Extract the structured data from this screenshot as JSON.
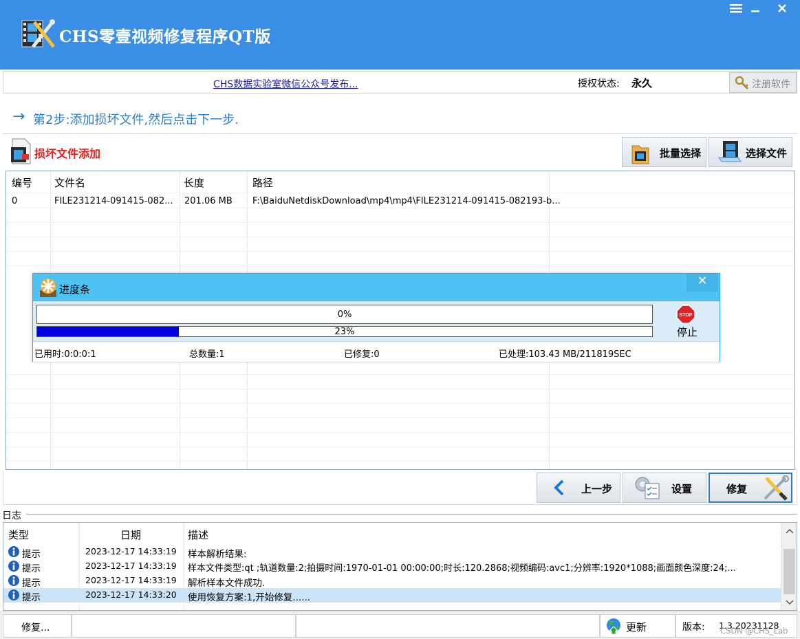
{
  "window": {
    "title": "CHS零壹视频修复程序QT版",
    "menu_icon": "hamburger-menu-icon",
    "minimize_icon": "minimize-icon",
    "close_icon": "close-icon"
  },
  "info": {
    "wechat_link": "CHS数据实验室微信公众号发布...",
    "auth_label": "授权状态:",
    "auth_value": "永久",
    "register_button": "注册软件"
  },
  "step": {
    "arrow": "→",
    "text": "第2步:添加损坏文件,然后点击下一步."
  },
  "add_section": {
    "title": "损坏文件添加",
    "batch_select": "批量选择",
    "select_file": "选择文件"
  },
  "file_table": {
    "columns": [
      "编号",
      "文件名",
      "长度",
      "路径"
    ],
    "rows": [
      [
        "0",
        "FILE231214-091415-082...",
        "201.06 MB",
        "F:\\BaiduNetdiskDownload\\mp4\\mp4\\FILE231214-091415-082193-b..."
      ]
    ]
  },
  "progress_dialog": {
    "title": "进度条",
    "bar1_label": "0%",
    "bar1_fraction": 0,
    "bar2_label": "23%",
    "bar2_fraction": 0.23,
    "stop_label": "停止",
    "stop_sign": "STOP",
    "close_symbol": "✕",
    "elapsed": "已用时:0:0:0:1",
    "total": "总数量:1",
    "repaired": "已修复:0",
    "processed": "已处理:103.43 MB/211819SEC"
  },
  "nav": {
    "prev": "上一步",
    "settings": "设置",
    "repair": "修复"
  },
  "log": {
    "section_label": "日志",
    "columns": [
      "类型",
      "日期",
      "描述"
    ],
    "rows": [
      {
        "type": "提示",
        "date": "2023-12-17 14:33:19",
        "desc": "样本解析结果:"
      },
      {
        "type": "提示",
        "date": "2023-12-17 14:33:19",
        "desc": "样本文件类型:qt ;轨道数量:2;拍摄时间:1970-01-01 00:00:00;时长:120.2868;视频编码:avc1;分辨率:1920*1088;画面颜色深度:24;..."
      },
      {
        "type": "提示",
        "date": "2023-12-17 14:33:19",
        "desc": "解析样本文件成功."
      },
      {
        "type": "提示",
        "date": "2023-12-17 14:33:20",
        "desc": "使用恢复方案:1,开始修复......"
      }
    ]
  },
  "statusbar": {
    "status": "修复...",
    "update": "更新",
    "version_label": "版本:",
    "version": "1.3.20231128",
    "watermark": "CSDN @CHS_Lab"
  },
  "colors": {
    "titlebar": "#3a8ee6",
    "step_text": "#2c7fcf",
    "add_title": "#e81a1a",
    "progress_fill": "#0000e0",
    "dialog_header": "#4ec2f2"
  }
}
